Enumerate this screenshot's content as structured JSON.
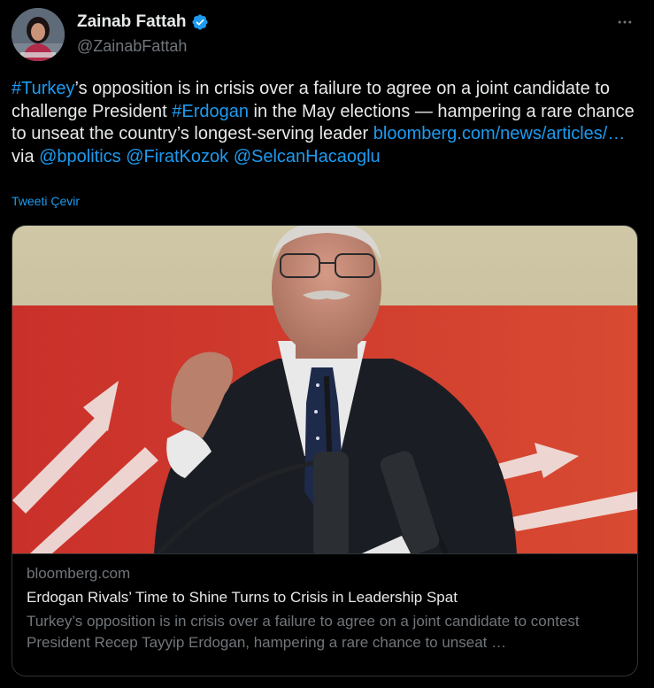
{
  "author": {
    "display_name": "Zainab Fattah",
    "handle": "@ZainabFattah",
    "verified": true
  },
  "tweet": {
    "hashtag_turkey": "#Turkey",
    "text_1": "’s opposition is in crisis over a failure to agree on a joint candidate to challenge President ",
    "hashtag_erdogan": "#Erdogan",
    "text_2": " in the May elections — hampering a rare chance to unseat the country’s longest-serving leader ",
    "url": "bloomberg.com/news/articles/…",
    "via": " via ",
    "mention_bpolitics": "@bpolitics",
    "mention_firat": "@FiratKozok",
    "mention_selcan": "@SelcanHacaoglu",
    "translate_label": "Tweeti Çevir"
  },
  "card": {
    "domain": "bloomberg.com",
    "title": "Erdogan Rivals’ Time to Shine Turns to Crisis in Leadership Spat",
    "description": "Turkey’s opposition is in crisis over a failure to agree on a joint candidate to contest President Recep Tayyip Erdogan, hampering a rare chance to unseat …"
  },
  "colors": {
    "background": "#000000",
    "text": "#e7e9ea",
    "secondary_text": "#71767b",
    "link": "#1d9bf0",
    "border": "#2f3336",
    "verified_badge": "#1d9bf0"
  },
  "icons": {
    "verified": "verified-badge-icon",
    "more": "more-horizontal-icon"
  }
}
